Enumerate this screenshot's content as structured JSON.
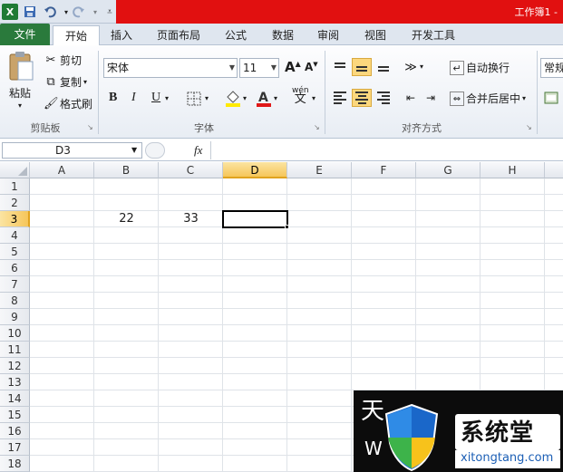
{
  "window": {
    "title": "工作簿1 -"
  },
  "qat": {
    "excel_icon": "excel-icon",
    "save_icon": "save-icon",
    "undo_icon": "undo-icon",
    "redo_icon": "redo-icon"
  },
  "tabs": [
    {
      "label": "文件"
    },
    {
      "label": "开始"
    },
    {
      "label": "插入"
    },
    {
      "label": "页面布局"
    },
    {
      "label": "公式"
    },
    {
      "label": "数据"
    },
    {
      "label": "审阅"
    },
    {
      "label": "视图"
    },
    {
      "label": "开发工具"
    }
  ],
  "clipboard": {
    "paste": "粘贴",
    "cut": "剪切",
    "copy": "复制",
    "format_painter": "格式刷",
    "group": "剪贴板"
  },
  "font": {
    "name": "宋体",
    "size": "11",
    "bold": "B",
    "italic": "I",
    "underline": "U",
    "grow": "A",
    "shrink": "A",
    "wen": "wén",
    "group": "字体"
  },
  "align": {
    "wrap": "自动换行",
    "merge": "合并后居中",
    "group": "对齐方式"
  },
  "number": {
    "format": "常规"
  },
  "formula_bar": {
    "name_box": "D3",
    "fx": "fx",
    "value": ""
  },
  "columns": [
    "A",
    "B",
    "C",
    "D",
    "E",
    "F",
    "G",
    "H"
  ],
  "rows": [
    "1",
    "2",
    "3",
    "4",
    "5",
    "6",
    "7",
    "8",
    "9",
    "10",
    "11",
    "12",
    "13",
    "14",
    "15",
    "16",
    "17",
    "18"
  ],
  "cells": {
    "B3": "22",
    "C3": "33"
  },
  "active_cell": "D3",
  "watermark": {
    "brand": "系统堂",
    "url": "xitongtang.com",
    "partial": "W",
    "partial_cn": "天"
  }
}
